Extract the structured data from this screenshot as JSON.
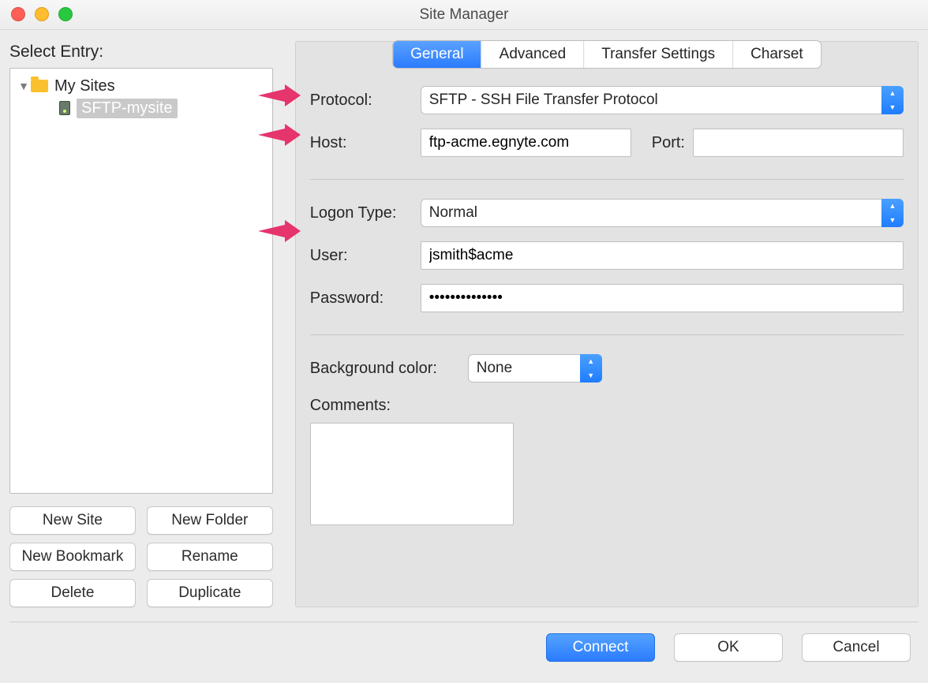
{
  "window": {
    "title": "Site Manager"
  },
  "left": {
    "select_entry": "Select Entry:",
    "root": "My Sites",
    "site_name": "SFTP-mysite",
    "buttons": {
      "new_site": "New Site",
      "new_folder": "New Folder",
      "new_bookmark": "New Bookmark",
      "rename": "Rename",
      "delete": "Delete",
      "duplicate": "Duplicate"
    }
  },
  "tabs": {
    "general": "General",
    "advanced": "Advanced",
    "transfer": "Transfer Settings",
    "charset": "Charset"
  },
  "general": {
    "protocol_label": "Protocol:",
    "protocol_value": "SFTP - SSH File Transfer Protocol",
    "host_label": "Host:",
    "host_value": "ftp-acme.egnyte.com",
    "port_label": "Port:",
    "port_value": "",
    "logon_type_label": "Logon Type:",
    "logon_type_value": "Normal",
    "user_label": "User:",
    "user_value": "jsmith$acme",
    "password_label": "Password:",
    "password_value": "••••••••••••••",
    "bg_color_label": "Background color:",
    "bg_color_value": "None",
    "comments_label": "Comments:",
    "comments_value": ""
  },
  "footer": {
    "connect": "Connect",
    "ok": "OK",
    "cancel": "Cancel"
  }
}
